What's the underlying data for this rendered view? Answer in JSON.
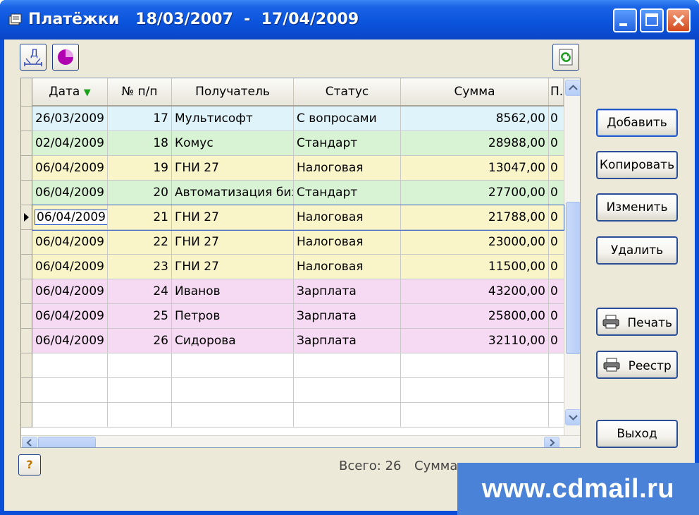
{
  "window": {
    "title_app": "Платёжки",
    "date_from": "18/03/2007",
    "date_sep": "-",
    "date_to": "17/04/2009"
  },
  "toolbar": {
    "icons": [
      "date-filter-icon",
      "pie-chart-icon",
      "refresh-icon"
    ]
  },
  "table": {
    "columns": [
      "Дата",
      "№ п/п",
      "Получатель",
      "Статус",
      "Сумма",
      "П."
    ],
    "sorted_column": "Дата",
    "rows": [
      {
        "date": "26/03/2009",
        "num": "17",
        "recipient": "Мультисофт",
        "status": "С вопросами",
        "sum": "8562,00",
        "p": "0",
        "color": "#dff4fa"
      },
      {
        "date": "02/04/2009",
        "num": "18",
        "recipient": "Комус",
        "status": "Стандарт",
        "sum": "28988,00",
        "p": "0",
        "color": "#d8f2d4"
      },
      {
        "date": "06/04/2009",
        "num": "19",
        "recipient": "ГНИ 27",
        "status": "Налоговая",
        "sum": "13047,00",
        "p": "0",
        "color": "#f9f5c9"
      },
      {
        "date": "06/04/2009",
        "num": "20",
        "recipient": "Автоматизация биз",
        "status": "Стандарт",
        "sum": "27700,00",
        "p": "0",
        "color": "#d8f2d4"
      },
      {
        "date": "06/04/2009",
        "num": "21",
        "recipient": "ГНИ 27",
        "status": "Налоговая",
        "sum": "21788,00",
        "p": "0",
        "color": "#f9f5c9",
        "current": true
      },
      {
        "date": "06/04/2009",
        "num": "22",
        "recipient": "ГНИ 27",
        "status": "Налоговая",
        "sum": "23000,00",
        "p": "0",
        "color": "#f9f5c9"
      },
      {
        "date": "06/04/2009",
        "num": "23",
        "recipient": "ГНИ 27",
        "status": "Налоговая",
        "sum": "11500,00",
        "p": "0",
        "color": "#f9f5c9"
      },
      {
        "date": "06/04/2009",
        "num": "24",
        "recipient": "Иванов",
        "status": "Зарплата",
        "sum": "43200,00",
        "p": "0",
        "color": "#f6d9f2"
      },
      {
        "date": "06/04/2009",
        "num": "25",
        "recipient": "Петров",
        "status": "Зарплата",
        "sum": "25800,00",
        "p": "0",
        "color": "#f6d9f2"
      },
      {
        "date": "06/04/2009",
        "num": "26",
        "recipient": "Сидорова",
        "status": "Зарплата",
        "sum": "32110,00",
        "p": "0",
        "color": "#f6d9f2"
      }
    ],
    "empty_rows": 3
  },
  "buttons": {
    "add": "Добавить",
    "copy": "Копировать",
    "edit": "Изменить",
    "delete": "Удалить",
    "print": "Печать",
    "registry": "Реестр",
    "exit": "Выход"
  },
  "status_bar": {
    "help": "?",
    "total_label": "Всего: 26",
    "sum_label": "Сумма"
  },
  "watermark": "www.cdmail.ru",
  "colors": {
    "title_bar": "#0b55dd",
    "row_info": "#dff4fa",
    "row_standard": "#d8f2d4",
    "row_tax": "#f9f5c9",
    "row_salary": "#f6d9f2"
  }
}
